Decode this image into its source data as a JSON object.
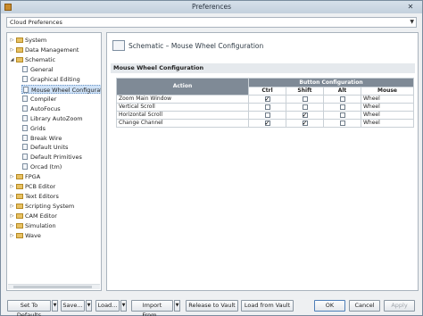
{
  "window": {
    "title": "Preferences",
    "close_glyph": "✕"
  },
  "scope": {
    "value": "Cloud Preferences"
  },
  "tree": [
    {
      "label": "System",
      "kind": "folder",
      "level": 0,
      "state": "collapsed"
    },
    {
      "label": "Data Management",
      "kind": "folder",
      "level": 0,
      "state": "collapsed"
    },
    {
      "label": "Schematic",
      "kind": "folder",
      "level": 0,
      "state": "expanded"
    },
    {
      "label": "General",
      "kind": "page",
      "level": 1
    },
    {
      "label": "Graphical Editing",
      "kind": "page",
      "level": 1
    },
    {
      "label": "Mouse Wheel Configuration",
      "kind": "page",
      "level": 1,
      "selected": true
    },
    {
      "label": "Compiler",
      "kind": "page",
      "level": 1
    },
    {
      "label": "AutoFocus",
      "kind": "page",
      "level": 1
    },
    {
      "label": "Library AutoZoom",
      "kind": "page",
      "level": 1
    },
    {
      "label": "Grids",
      "kind": "page",
      "level": 1
    },
    {
      "label": "Break Wire",
      "kind": "page",
      "level": 1
    },
    {
      "label": "Default Units",
      "kind": "page",
      "level": 1
    },
    {
      "label": "Default Primitives",
      "kind": "page",
      "level": 1
    },
    {
      "label": "Orcad (tm)",
      "kind": "page",
      "level": 1
    },
    {
      "label": "FPGA",
      "kind": "folder",
      "level": 0,
      "state": "collapsed"
    },
    {
      "label": "PCB Editor",
      "kind": "folder",
      "level": 0,
      "state": "collapsed"
    },
    {
      "label": "Text Editors",
      "kind": "folder",
      "level": 0,
      "state": "collapsed"
    },
    {
      "label": "Scripting System",
      "kind": "folder",
      "level": 0,
      "state": "collapsed"
    },
    {
      "label": "CAM Editor",
      "kind": "folder",
      "level": 0,
      "state": "collapsed"
    },
    {
      "label": "Simulation",
      "kind": "folder",
      "level": 0,
      "state": "collapsed"
    },
    {
      "label": "Wave",
      "kind": "folder",
      "level": 0,
      "state": "collapsed"
    }
  ],
  "panel": {
    "title": "Schematic – Mouse Wheel Configuration",
    "section": "Mouse Wheel Configuration",
    "table": {
      "action_header": "Action",
      "config_header": "Button Configuration",
      "sub_headers": [
        "Ctrl",
        "Shift",
        "Alt",
        "Mouse"
      ],
      "rows": [
        {
          "action": "Zoom Main Window",
          "ctrl": true,
          "shift": false,
          "alt": false,
          "mouse": "Wheel"
        },
        {
          "action": "Vertical Scroll",
          "ctrl": false,
          "shift": false,
          "alt": false,
          "mouse": "Wheel"
        },
        {
          "action": "Horizontal Scroll",
          "ctrl": false,
          "shift": true,
          "alt": false,
          "mouse": "Wheel"
        },
        {
          "action": "Change Channel",
          "ctrl": true,
          "shift": true,
          "alt": false,
          "mouse": "Wheel"
        }
      ]
    }
  },
  "buttons": {
    "set_defaults": "Set To Defaults",
    "save": "Save...",
    "load": "Load...",
    "import_from": "Import From...",
    "release_to_vault": "Release to Vault",
    "load_from_vault": "Load from Vault",
    "ok": "OK",
    "cancel": "Cancel",
    "apply": "Apply"
  }
}
